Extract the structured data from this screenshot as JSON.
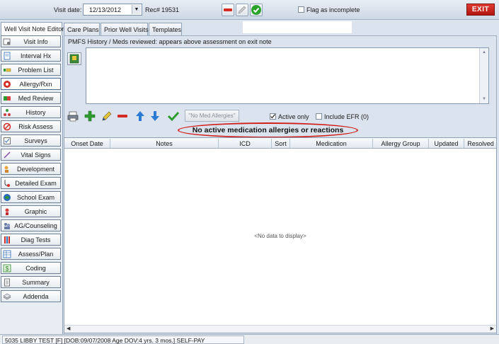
{
  "header": {
    "visit_date_label": "Visit date:",
    "visit_date_value": "12/13/2012",
    "rec_label": "Rec#",
    "rec_value": "19531",
    "flag_label": "Flag as incomplete",
    "exit_label": "EXIT"
  },
  "tabs": [
    {
      "label": "Well Visit Note Editor",
      "active": true
    },
    {
      "label": "Care Plans",
      "active": false
    },
    {
      "label": "Prior Well Visits",
      "active": false
    },
    {
      "label": "Templates",
      "active": false
    }
  ],
  "sidebar": {
    "items": [
      {
        "label": "Visit Info",
        "icon": "stethoscope-icon"
      },
      {
        "label": "Interval Hx",
        "icon": "document-icon"
      },
      {
        "label": "Problem List",
        "icon": "list-icon"
      },
      {
        "label": "Allergy/Rxn",
        "icon": "allergy-icon",
        "active": true
      },
      {
        "label": "Med Review",
        "icon": "medicine-icon"
      },
      {
        "label": "History",
        "icon": "family-tree-icon"
      },
      {
        "label": "Risk Assess",
        "icon": "no-sign-icon"
      },
      {
        "label": "Surveys",
        "icon": "checklist-icon"
      },
      {
        "label": "Vital Signs",
        "icon": "thermometer-icon"
      },
      {
        "label": "Development",
        "icon": "development-icon"
      },
      {
        "label": "Detailed Exam",
        "icon": "stethoscope-exam-icon"
      },
      {
        "label": "School Exam",
        "icon": "school-icon"
      },
      {
        "label": "Graphic",
        "icon": "graph-icon"
      },
      {
        "label": "AG/Counseling",
        "icon": "counseling-icon"
      },
      {
        "label": "Diag Tests",
        "icon": "test-tube-icon"
      },
      {
        "label": "Assess/Plan",
        "icon": "plan-icon"
      },
      {
        "label": "Coding",
        "icon": "dollar-icon"
      },
      {
        "label": "Summary",
        "icon": "summary-icon"
      },
      {
        "label": "Addenda",
        "icon": "addenda-icon"
      }
    ]
  },
  "main": {
    "pmfs_label": "PMFS History / Meds reviewed: appears above assessment on exit note",
    "textarea_value": "",
    "no_med_allergies_label": "\"No Med Allergies\"",
    "active_only_label": "Active only",
    "active_only_checked": true,
    "include_efr_label": "Include EFR (0)",
    "include_efr_checked": false,
    "headline": "No active medication allergies or reactions",
    "columns": [
      "Onset Date",
      "Notes",
      "ICD",
      "Sort",
      "Medication",
      "Allergy Group",
      "Updated",
      "Resolved"
    ],
    "rows": [],
    "empty_text": "<No data to display>"
  },
  "status": {
    "patient_text": "5035 LIBBY TEST  [F]  [DOB:09/07/2008  Age DOV:4 yrs. 3 mos.]  SELF-PAY"
  },
  "colors": {
    "exit_red": "#c8211a",
    "highlight_ellipse": "#d0201b",
    "add_green": "#2e9b2e",
    "arrow_blue": "#2b7bd6"
  }
}
